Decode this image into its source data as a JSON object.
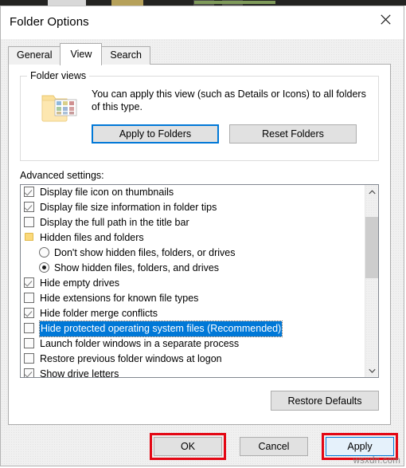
{
  "window": {
    "title": "Folder Options",
    "close_icon": "close-icon"
  },
  "tabs": [
    {
      "label": "General",
      "active": false
    },
    {
      "label": "View",
      "active": true
    },
    {
      "label": "Search",
      "active": false
    }
  ],
  "folder_views": {
    "legend": "Folder views",
    "icon": "folder-thumbnails-icon",
    "description": "You can apply this view (such as Details or Icons) to all folders of this type.",
    "apply_to_folders_label": "Apply to Folders",
    "reset_folders_label": "Reset Folders",
    "focus_color": "#0078d7"
  },
  "advanced": {
    "label": "Advanced settings:",
    "selection_color": "#0078d7",
    "items": [
      {
        "type": "checkbox",
        "label": "Display file icon on thumbnails",
        "checked": true,
        "indent": false,
        "selected": false
      },
      {
        "type": "checkbox",
        "label": "Display file size information in folder tips",
        "checked": true,
        "indent": false,
        "selected": false
      },
      {
        "type": "checkbox",
        "label": "Display the full path in the title bar",
        "checked": false,
        "indent": false,
        "selected": false
      },
      {
        "type": "group",
        "label": "Hidden files and folders",
        "checked": false,
        "indent": false,
        "selected": false
      },
      {
        "type": "radio",
        "label": "Don't show hidden files, folders, or drives",
        "checked": false,
        "indent": true,
        "selected": false
      },
      {
        "type": "radio",
        "label": "Show hidden files, folders, and drives",
        "checked": true,
        "indent": true,
        "selected": false
      },
      {
        "type": "checkbox",
        "label": "Hide empty drives",
        "checked": true,
        "indent": false,
        "selected": false
      },
      {
        "type": "checkbox",
        "label": "Hide extensions for known file types",
        "checked": false,
        "indent": false,
        "selected": false
      },
      {
        "type": "checkbox",
        "label": "Hide folder merge conflicts",
        "checked": true,
        "indent": false,
        "selected": false
      },
      {
        "type": "checkbox",
        "label": "Hide protected operating system files (Recommended)",
        "checked": false,
        "indent": false,
        "selected": true
      },
      {
        "type": "checkbox",
        "label": "Launch folder windows in a separate process",
        "checked": false,
        "indent": false,
        "selected": false
      },
      {
        "type": "checkbox",
        "label": "Restore previous folder windows at logon",
        "checked": false,
        "indent": false,
        "selected": false
      },
      {
        "type": "checkbox",
        "label": "Show drive letters",
        "checked": true,
        "indent": false,
        "selected": false
      }
    ],
    "scrollbar": {
      "up_icon": "chevron-up-icon",
      "down_icon": "chevron-down-icon"
    },
    "restore_defaults_label": "Restore Defaults"
  },
  "footer": {
    "ok_label": "OK",
    "cancel_label": "Cancel",
    "apply_label": "Apply",
    "annotation_color": "#e30613"
  },
  "watermark": "wsxdn.com"
}
